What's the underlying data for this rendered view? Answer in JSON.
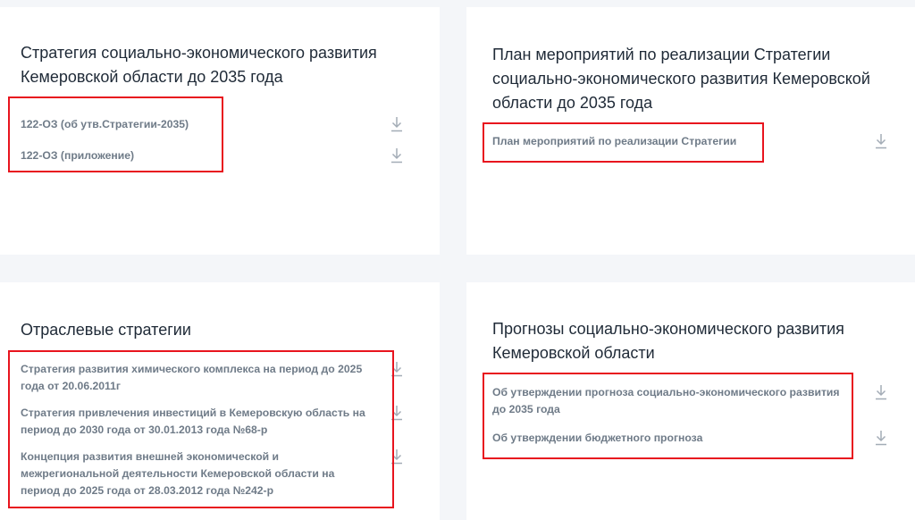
{
  "cards": {
    "strategy": {
      "title": "Стратегия социально-экономического развития Кемеровской области до 2035 года",
      "docs": [
        {
          "label": "122-ОЗ (об утв.Стратегии-2035)",
          "icon": "download-icon"
        },
        {
          "label": "122-ОЗ (приложение)",
          "icon": "download-icon"
        }
      ]
    },
    "plan": {
      "title": "План мероприятий по реализации Стратегии социально-экономического развития Кемеровской области до 2035 года",
      "docs": [
        {
          "label": "План мероприятий по реализации Стратегии",
          "icon": "download-icon"
        }
      ]
    },
    "sectoral": {
      "title": "Отраслевые стратегии",
      "docs": [
        {
          "label": "Стратегия развития химического комплекса на период до 2025 года от 20.06.2011г",
          "icon": "download-icon"
        },
        {
          "label": "Стратегия привлечения инвестиций в Кемеровскую область на период до 2030 года от 30.01.2013 года №68-р",
          "icon": "download-icon"
        },
        {
          "label": "Концепция развития внешней экономической и межрегиональной деятельности Кемеровской области на период до 2025 года от 28.03.2012 года №242-р",
          "icon": "download-icon"
        }
      ]
    },
    "forecasts": {
      "title": "Прогнозы социально-экономического развития Кемеровской области",
      "docs": [
        {
          "label": "Об утверждении прогноза социально-экономического развития до 2035 года",
          "icon": "download-icon"
        },
        {
          "label": "Об утверждении бюджетного прогноза",
          "icon": "download-icon"
        }
      ]
    }
  },
  "colors": {
    "highlight": "#e8141e",
    "title": "#1f2a37",
    "link": "#6f7b88",
    "icon": "#a3acb6",
    "background": "#f4f6f9"
  }
}
